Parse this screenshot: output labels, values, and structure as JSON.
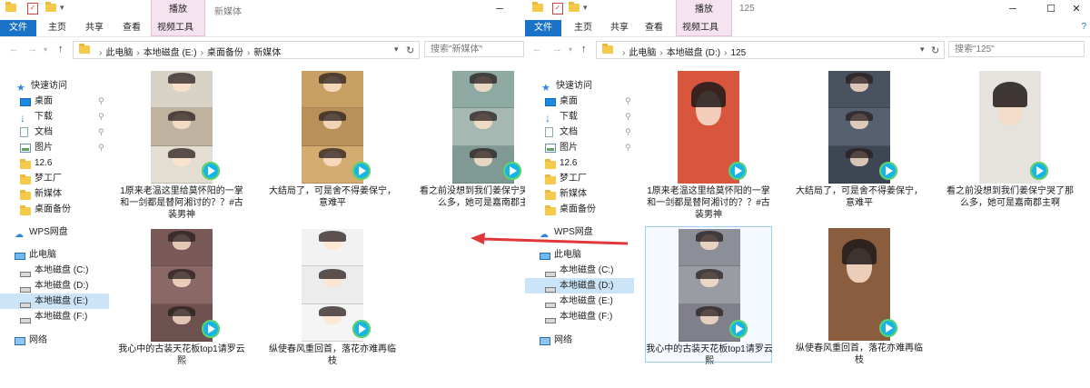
{
  "tool_tab": "播放",
  "ribbon_tabs": {
    "file": "文件",
    "home": "主页",
    "share": "共享",
    "view": "查看",
    "video_tools": "视频工具"
  },
  "window_controls": {
    "minimize": "─",
    "maximize": "☐",
    "close": "✕"
  },
  "nav": {
    "quick_access": "快速访问",
    "desktop": "桌面",
    "downloads": "下载",
    "documents": "文档",
    "pictures": "图片",
    "folder_126": "12.6",
    "dream_factory": "梦工厂",
    "new_media": "新媒体",
    "desktop_backup": "桌面备份",
    "wps": "WPS网盘",
    "this_pc": "此电脑",
    "drive_c": "本地磁盘 (C:)",
    "drive_d": "本地磁盘 (D:)",
    "drive_e": "本地磁盘 (E:)",
    "drive_f": "本地磁盘 (F:)",
    "network": "网络"
  },
  "left_window": {
    "title": "新媒体",
    "path": [
      "此电脑",
      "本地磁盘 (E:)",
      "桌面备份",
      "新媒体"
    ],
    "search_placeholder": "搜索\"新媒体\"",
    "selected_nav": "drive_e",
    "files": [
      {
        "name": "1原来老温这里给莫怀阳的一掌和一剑都是替阿湘讨的？？#古装男神",
        "thumb": "triple",
        "colors": [
          "#d9d2c6",
          "#bfb3a0",
          "#e3ddd2"
        ]
      },
      {
        "name": "大结局了，可是舍不得姜保宁，意难平",
        "thumb": "triple",
        "colors": [
          "#c8a064",
          "#b8905a",
          "#d2ac70"
        ]
      },
      {
        "name": "看之前没想到我们姜保宁哭了那么多，她可是嘉南郡主",
        "thumb": "triple",
        "colors": [
          "#8fa9a3",
          "#a5b8b1",
          "#7f9a94"
        ]
      },
      {
        "name": "我心中的古装天花板top1请罗云熙",
        "thumb": "triple",
        "colors": [
          "#7a5a58",
          "#8a6866",
          "#6e5250"
        ]
      },
      {
        "name": "纵使春风重回首，落花亦难再临枝",
        "thumb": "triple",
        "colors": [
          "#f2f2f2",
          "#ececec",
          "#f5f5f5"
        ]
      }
    ]
  },
  "right_window": {
    "title": "125",
    "path": [
      "此电脑",
      "本地磁盘 (D:)",
      "125"
    ],
    "search_placeholder": "搜索\"125\"",
    "selected_nav": "drive_d",
    "files": [
      {
        "name": "1原来老温这里给莫怀阳的一掌和一剑都是替阿湘讨的？？#古装男神",
        "thumb": "single",
        "colors": [
          "#d8563e"
        ]
      },
      {
        "name": "大结局了，可是舍不得姜保宁，意难平",
        "thumb": "triple",
        "colors": [
          "#4a5260",
          "#56606e",
          "#3e4654"
        ]
      },
      {
        "name": "看之前没想到我们姜保宁哭了那么多，她可是嘉南郡主啊",
        "thumb": "single",
        "colors": [
          "#e6e3de"
        ]
      },
      {
        "name": "我心中的古装天花板top1请罗云熙",
        "thumb": "triple",
        "colors": [
          "#8d8f98",
          "#9a9ca4",
          "#7f8089"
        ]
      },
      {
        "name": "纵使春风重回首，落花亦难再临枝",
        "thumb": "single",
        "colors": [
          "#8a5d3f"
        ]
      }
    ]
  },
  "accent_colors": {
    "file_tab": "#1b73c8",
    "tool_tab": "#f6e3f0",
    "nav_selected": "#cce4f7",
    "arrow": "#e0383a"
  }
}
